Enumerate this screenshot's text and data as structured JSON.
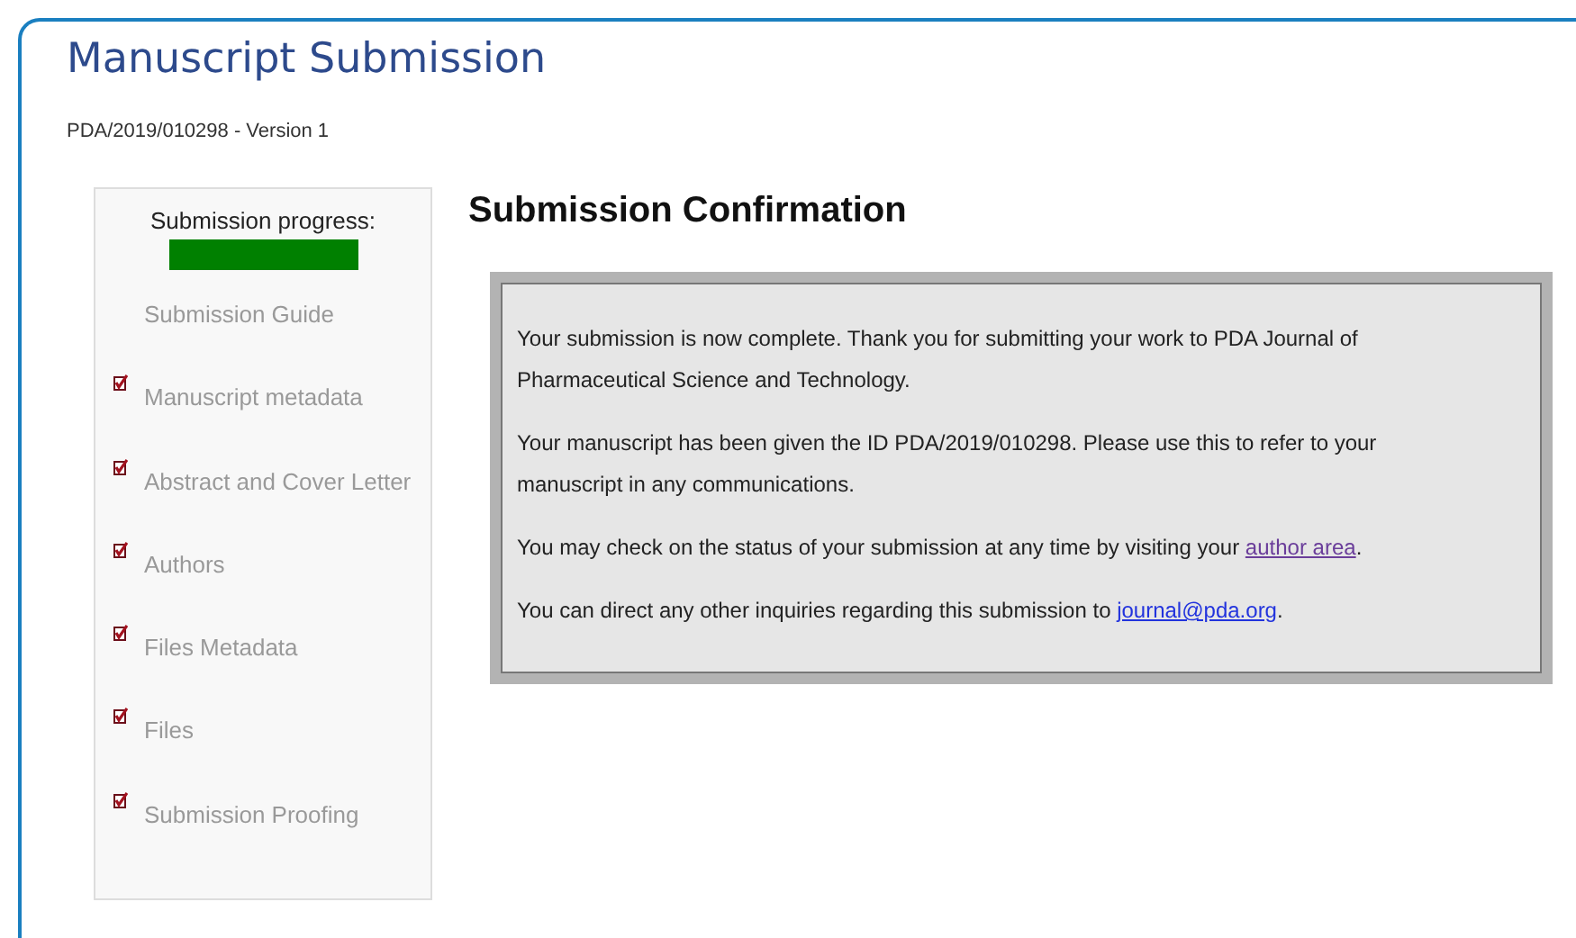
{
  "page": {
    "title": "Manuscript Submission",
    "reference": "PDA/2019/010298 - Version 1"
  },
  "sidebar": {
    "progress_label": "Submission progress:",
    "items": [
      {
        "label": "Submission Guide",
        "kind": "guide"
      },
      {
        "label": "Manuscript metadata",
        "kind": "step"
      },
      {
        "label": "Abstract and Cover Letter",
        "kind": "step"
      },
      {
        "label": "Authors",
        "kind": "step"
      },
      {
        "label": "Files Metadata",
        "kind": "step"
      },
      {
        "label": "Files",
        "kind": "step"
      },
      {
        "label": "Submission Proofing",
        "kind": "step"
      }
    ]
  },
  "confirmation": {
    "heading": "Submission Confirmation",
    "paragraphs": [
      {
        "text": "Your submission is now complete. Thank you for submitting your work to PDA Journal of Pharmaceutical Science and Technology."
      },
      {
        "text": "Your manuscript has been given the ID PDA/2019/010298. Please use this to refer to your manuscript in any communications."
      },
      {
        "text": "You may check on the status of your submission at any time by visiting your ",
        "link": {
          "text": "author area",
          "visited": true
        },
        "after": "."
      },
      {
        "text": "You can direct any other inquiries regarding this submission to ",
        "link": {
          "text": "journal@pda.org",
          "visited": false
        },
        "after": "."
      }
    ]
  }
}
